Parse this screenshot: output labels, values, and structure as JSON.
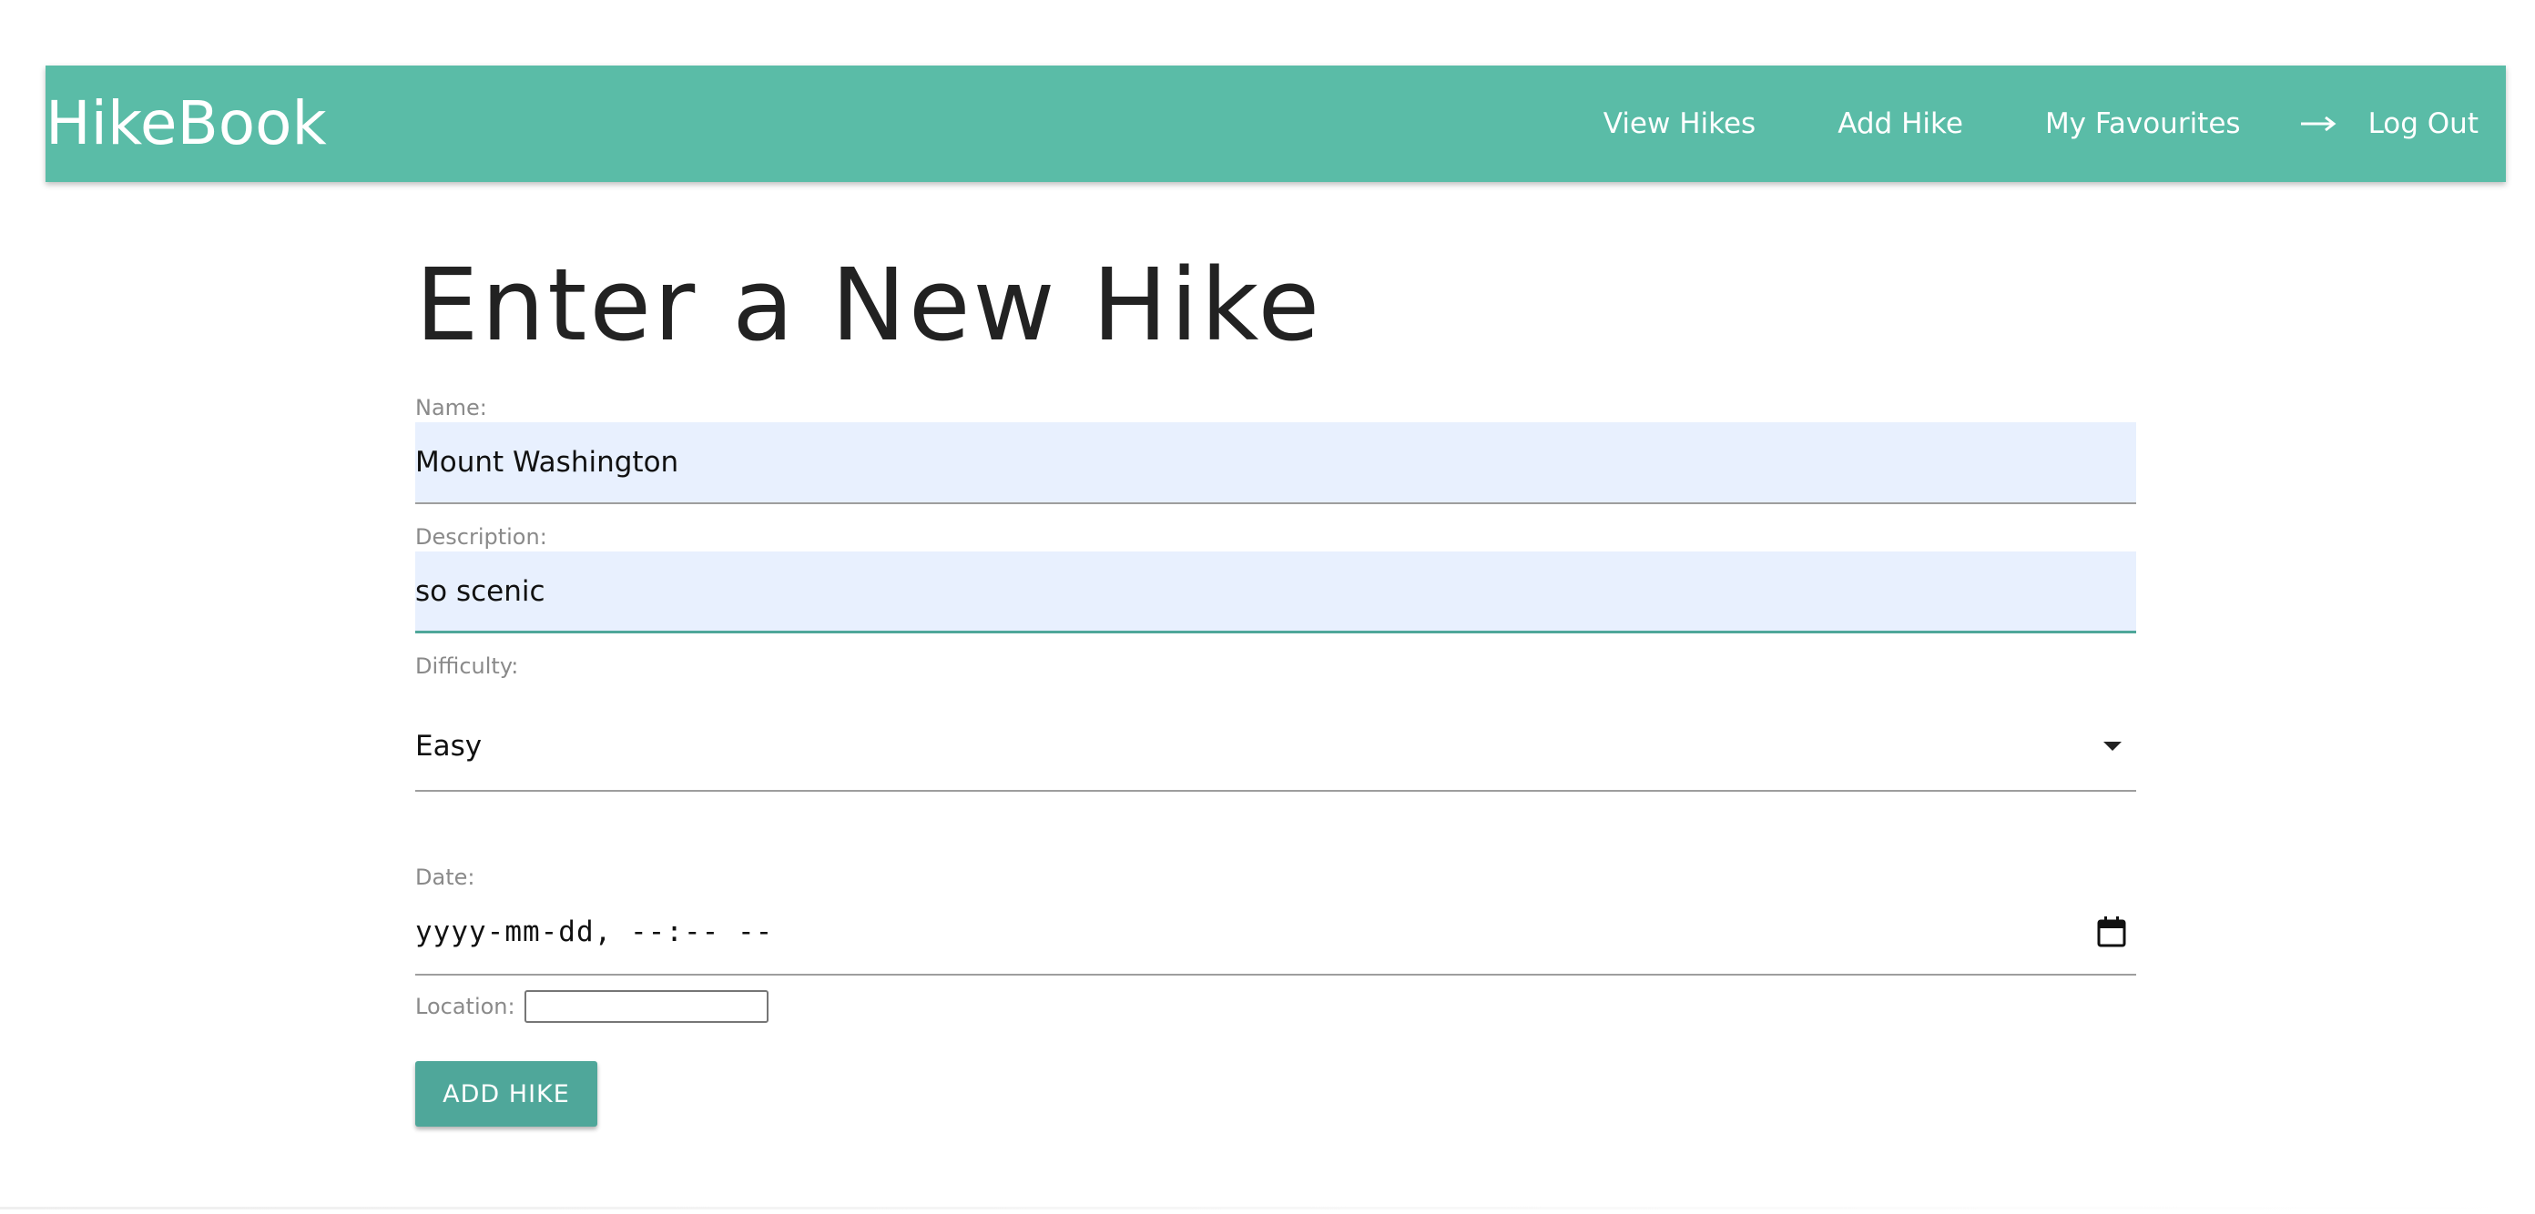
{
  "navbar": {
    "brand": "HikeBook",
    "links": {
      "view_hikes": "View Hikes",
      "add_hike": "Add Hike",
      "my_favourites": "My Favourites",
      "log_out": "Log Out"
    },
    "logout_icon": "arrow-right-icon"
  },
  "form": {
    "title": "Enter a New Hike",
    "name": {
      "label": "Name:",
      "value": "Mount Washington"
    },
    "description": {
      "label": "Description:",
      "value": "so scenic"
    },
    "difficulty": {
      "label": "Difficulty:",
      "selected": "Easy"
    },
    "date": {
      "label": "Date:",
      "placeholder": "yyyy-mm-dd, --:-- --"
    },
    "location": {
      "label": "Location:",
      "value": ""
    },
    "submit_label": "ADD HIKE"
  },
  "colors": {
    "navbar_bg": "#5abca7",
    "button_bg": "#4fa79a",
    "input_bg": "#e8f0fe",
    "focus_underline": "#4fa79a"
  }
}
